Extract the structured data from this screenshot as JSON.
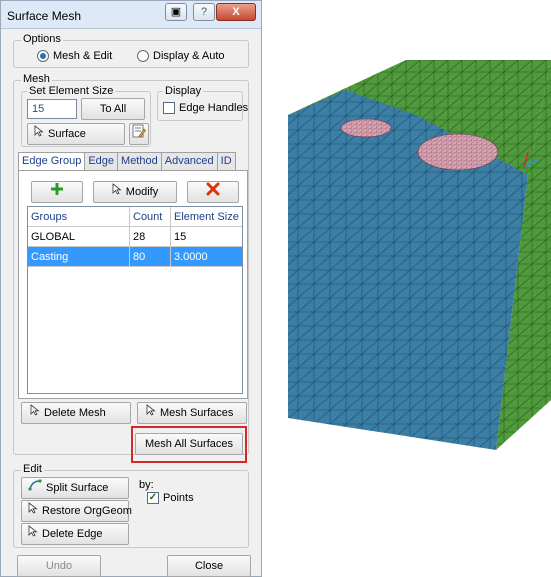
{
  "window": {
    "title": "Surface Mesh",
    "close_glyph": "X",
    "help_glyph": "?"
  },
  "options": {
    "label": "Options",
    "radio_mesh_edit": "Mesh & Edit",
    "radio_display_auto": "Display & Auto",
    "selected": "Mesh & Edit"
  },
  "mesh": {
    "label": "Mesh",
    "set_element_size_label": "Set Element Size",
    "element_size_value": "15",
    "to_all_button": "To All",
    "surface_button": "Surface",
    "display_label": "Display",
    "edge_handles_label": "Edge Handles",
    "edge_handles_checked": false
  },
  "tabs": [
    "Edge Group",
    "Edge",
    "Method",
    "Advanced",
    "ID"
  ],
  "active_tab": "Edge Group",
  "edge_group": {
    "modify_button": "Modify",
    "add_icon": "plus-icon",
    "delete_icon": "x-icon",
    "columns": [
      "Groups",
      "Count",
      "Element Size"
    ],
    "rows": [
      {
        "group": "GLOBAL",
        "count": "28",
        "size": "15",
        "selected": false
      },
      {
        "group": "Casting",
        "count": "80",
        "size": "3.0000",
        "selected": true
      }
    ]
  },
  "actions": {
    "delete_mesh": "Delete Mesh",
    "mesh_surfaces": "Mesh Surfaces",
    "mesh_all_surfaces": "Mesh All Surfaces"
  },
  "edit": {
    "label": "Edit",
    "split_surface": "Split Surface",
    "restore_orggeom": "Restore OrgGeom",
    "delete_edge": "Delete Edge",
    "by_label": "by:",
    "points_label": "Points",
    "points_checked": true
  },
  "footer": {
    "undo": "Undo",
    "close": "Close"
  },
  "colors": {
    "selection_blue": "#3399ff",
    "highlight_red": "#d4282a",
    "mesh_front": "#3b7fa6",
    "mesh_top_green": "#4f9a3c",
    "mesh_side_green": "#4a9a3a",
    "casting_pink": "#d8a5b4"
  }
}
